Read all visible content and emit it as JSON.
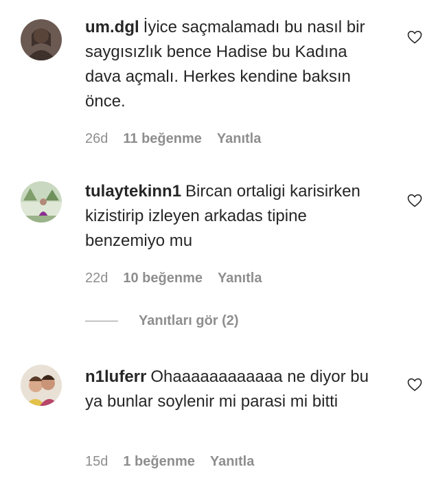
{
  "comments": [
    {
      "username": "um.dgl",
      "text": "İyice saçmalamadı bu nasıl bir saygısızlık bence Hadise bu Kadına dava açmalı. Herkes kendine baksın önce.",
      "time": "26d",
      "likes": "11 beğenme",
      "reply": "Yanıtla",
      "avatar_icon": "profile-photo-icon"
    },
    {
      "username": "tulaytekinn1",
      "text": "Bircan ortaligi karisirken kizistirip izleyen arkadas tipine benzemiyo mu",
      "time": "22d",
      "likes": "10 beğenme",
      "reply": "Yanıtla",
      "avatar_icon": "profile-photo-icon"
    },
    {
      "username": "n1luferr",
      "text": "Ohaaaaaaaaaaaa ne diyor bu ya bunlar soylenir mi parasi mi bitti",
      "time": "15d",
      "likes": "1 beğenme",
      "reply": "Yanıtla",
      "avatar_icon": "profile-photo-icon"
    }
  ],
  "view_replies": "Yanıtları gör (2)",
  "like_icon": "heart-outline-icon",
  "colors": {
    "text": "#262626",
    "secondary": "#8e8e8e"
  }
}
